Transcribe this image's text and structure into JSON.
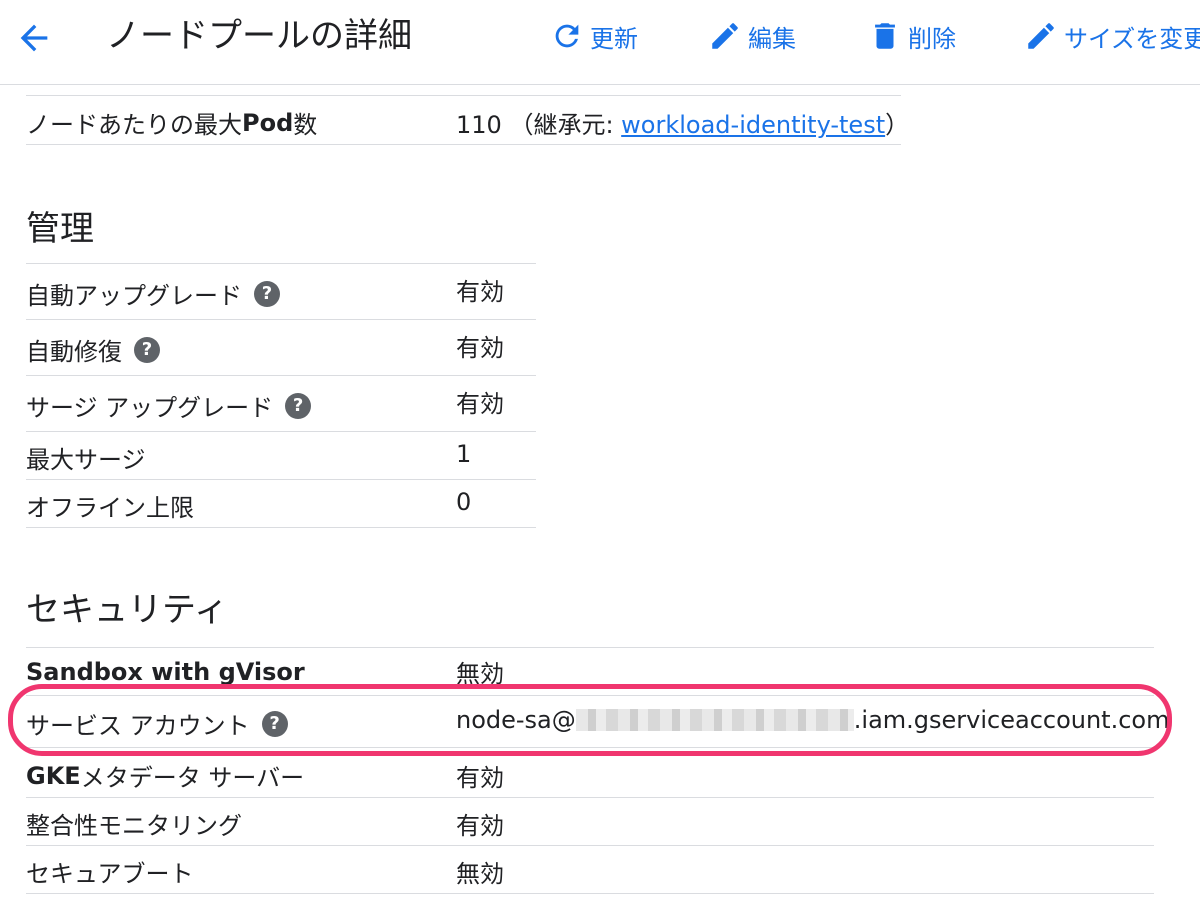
{
  "header": {
    "title": "ノードプールの詳細",
    "refresh_label": "更新",
    "edit_label": "編集",
    "delete_label": "削除",
    "resize_label": "サイズを変更"
  },
  "top_row": {
    "label_prefix": "ノードあたりの最大 ",
    "label_bold": "Pod",
    "label_suffix": " 数",
    "value_number": "110",
    "value_open": "（継承元: ",
    "value_link": "workload-identity-test",
    "value_close": "）"
  },
  "management": {
    "title": "管理",
    "rows": [
      {
        "label": "自動アップグレード",
        "value": "有効"
      },
      {
        "label": "自動修復",
        "value": "有効"
      },
      {
        "label": "サージ アップグレード",
        "value": "有効"
      },
      {
        "label": "最大サージ",
        "value": "1"
      },
      {
        "label": "オフライン上限",
        "value": "0"
      }
    ]
  },
  "security": {
    "title": "セキュリティ",
    "rows": [
      {
        "label": "Sandbox with gVisor",
        "value": "無効"
      },
      {
        "label": "サービス アカウント",
        "value_prefix": "node-sa@",
        "value_suffix": ".iam.gserviceaccount.com"
      },
      {
        "label_bold": "GKE",
        "label": " メタデータ サーバー",
        "value": "有効"
      },
      {
        "label": "整合性モニタリング",
        "value": "有効"
      },
      {
        "label": "セキュアブート",
        "value": "無効"
      }
    ]
  },
  "colors": {
    "accent": "#1a73e8",
    "highlight": "#f0366f",
    "help_icon": "#5f6368"
  }
}
